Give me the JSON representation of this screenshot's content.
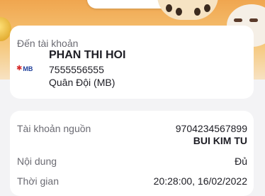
{
  "recipient": {
    "section_label": "Đến tài khoản",
    "name": "PHAN THI HOI",
    "account_number": "7555556555",
    "bank_name": "Quân Đội (MB)",
    "bank_logo_text": "MB",
    "bank_logo_star": "✱"
  },
  "details": {
    "source_label": "Tài khoản nguồn",
    "source_account": "9704234567899",
    "source_holder": "BUI KIM TU",
    "content_label": "Nội dung",
    "content_value": "Đủ",
    "time_label": "Thời gian",
    "time_value": "20:28:00, 16/02/2022"
  },
  "colors": {
    "banner_orange": "#f0a64f",
    "bank_red": "#d62a2a",
    "bank_blue": "#1f3f9a"
  }
}
